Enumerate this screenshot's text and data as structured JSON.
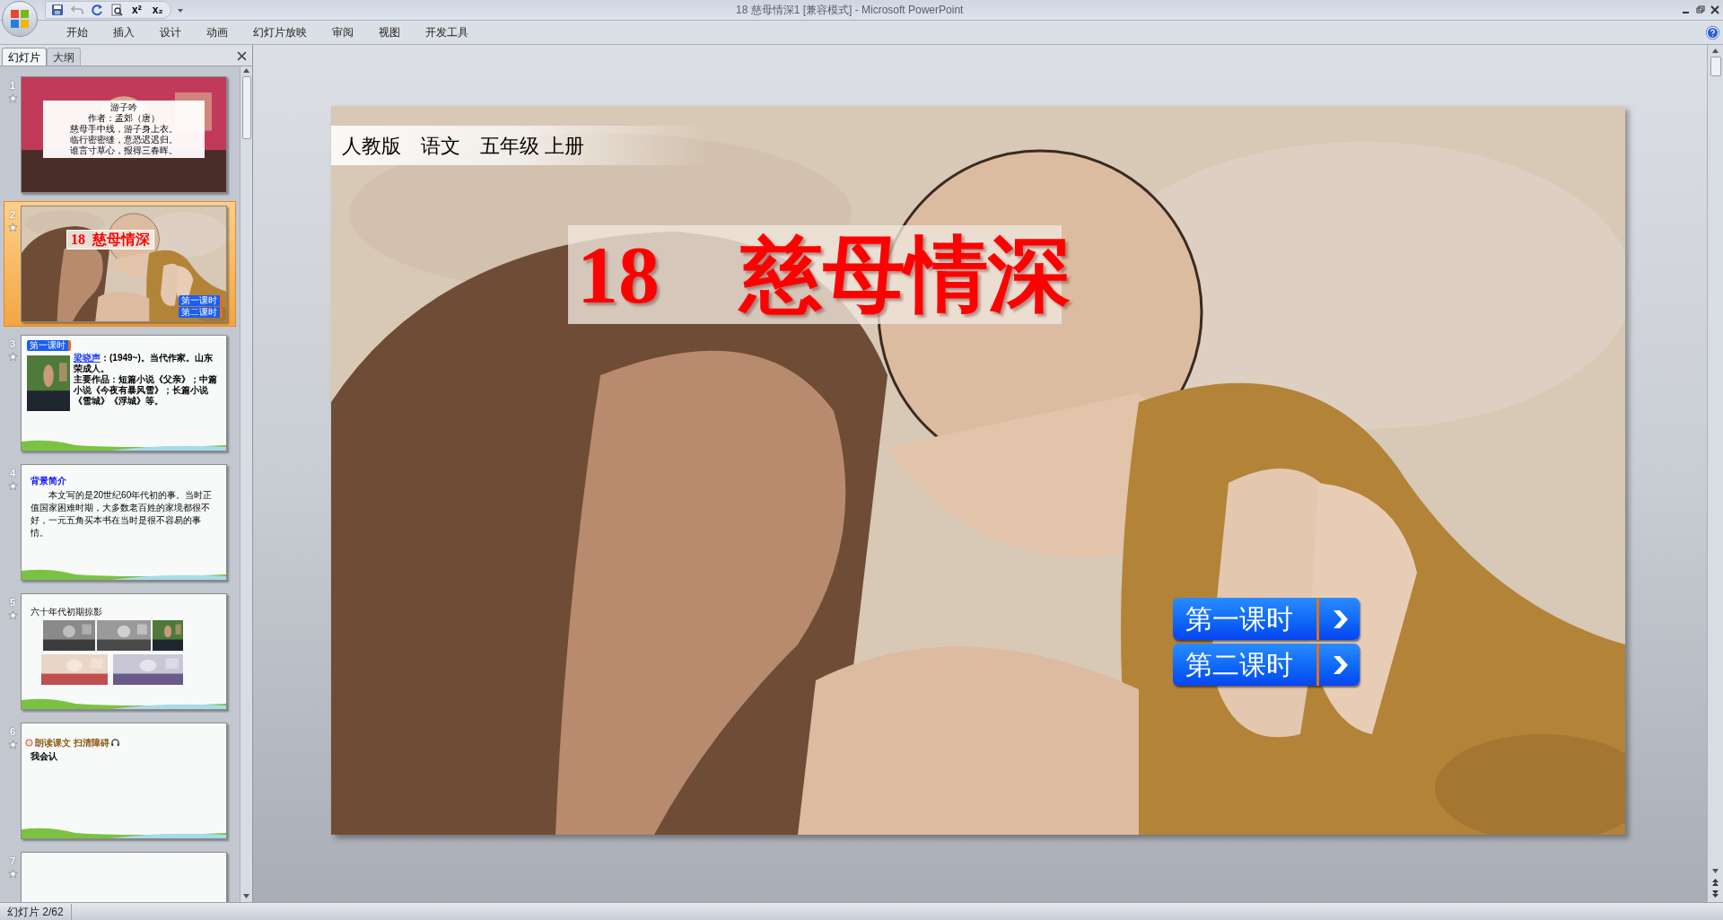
{
  "window": {
    "title": "18 慈母情深1 [兼容模式] - Microsoft PowerPoint"
  },
  "quick_access": [
    {
      "kind": "save"
    },
    {
      "kind": "undo"
    },
    {
      "kind": "redo"
    },
    {
      "kind": "preview"
    },
    {
      "kind": "glyph",
      "text": "x²"
    },
    {
      "kind": "glyph",
      "text": "x₂"
    }
  ],
  "ribbon_tabs": [
    "开始",
    "插入",
    "设计",
    "动画",
    "幻灯片放映",
    "审阅",
    "视图",
    "开发工具"
  ],
  "panel_tabs": [
    {
      "label": "幻灯片",
      "selected": true
    },
    {
      "label": "大纲",
      "selected": false
    }
  ],
  "slides": [
    {
      "number": "1",
      "selected": false,
      "kind": "poem",
      "lines": [
        "游子吟",
        "作者：孟郊（唐）",
        "慈母手中线，游子身上衣。",
        "临行密密缝，意恐迟迟归。",
        "谁言寸草心，报得三春晖。"
      ]
    },
    {
      "number": "2",
      "selected": true,
      "kind": "cover",
      "title_number": "18",
      "title": "慈母情深",
      "buttons": [
        "第一课时",
        "第二课时"
      ]
    },
    {
      "number": "3",
      "selected": false,
      "kind": "author",
      "button": "第一课时",
      "name": "梁晓声",
      "paragraphs": [
        "：(1949~)。当代作家。山东荣成人。",
        "主要作品：短篇小说《父亲》；中篇小说《今夜有暴风雪》；长篇小说《雪城》《浮城》等。"
      ]
    },
    {
      "number": "4",
      "selected": false,
      "kind": "text",
      "heading": "背景简介",
      "body": "本文写的是20世纪60年代初的事。当时正值国家困难时期，大多数老百姓的家境都很不好，一元五角买本书在当时是很不容易的事情。"
    },
    {
      "number": "5",
      "selected": false,
      "kind": "photos",
      "heading": "六十年代初期掠影"
    },
    {
      "number": "6",
      "selected": false,
      "kind": "reading",
      "heading": "朗读课文 扫清障碍",
      "subheading": "我会认"
    },
    {
      "number": "7",
      "selected": false,
      "kind": "blank"
    }
  ],
  "slide": {
    "header": [
      "人教版",
      "语文",
      "五年级 上册"
    ],
    "number": "18",
    "title": "慈母情深",
    "buttons": [
      "第一课时",
      "第二课时"
    ]
  },
  "status_bar": {
    "slide_position": "幻灯片 2/62"
  }
}
